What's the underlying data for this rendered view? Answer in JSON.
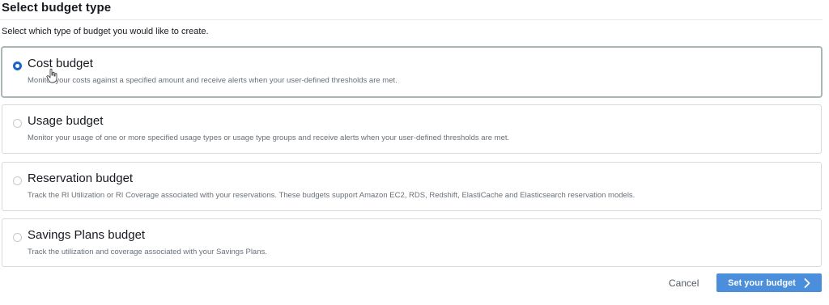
{
  "header": {
    "title": "Select budget type",
    "subtitle": "Select which type of budget you would like to create."
  },
  "options": [
    {
      "label": "Cost budget",
      "description": "Monitor your costs against a specified amount and receive alerts when your user-defined thresholds are met.",
      "selected": true
    },
    {
      "label": "Usage budget",
      "description": "Monitor your usage of one or more specified usage types or usage type groups and receive alerts when your user-defined thresholds are met.",
      "selected": false
    },
    {
      "label": "Reservation budget",
      "description": "Track the RI Utilization or RI Coverage associated with your reservations. These budgets support Amazon EC2, RDS, Redshift, ElastiCache and Elasticsearch reservation models.",
      "selected": false
    },
    {
      "label": "Savings Plans budget",
      "description": "Track the utilization and coverage associated with your Savings Plans.",
      "selected": false
    }
  ],
  "footer": {
    "cancel_label": "Cancel",
    "primary_label": "Set your budget",
    "primary_icon": "chevron-right-icon"
  },
  "colors": {
    "primary_button": "#4b8fdc",
    "radio_checked": "#1b65c7",
    "card_border": "#d5dbdb"
  }
}
